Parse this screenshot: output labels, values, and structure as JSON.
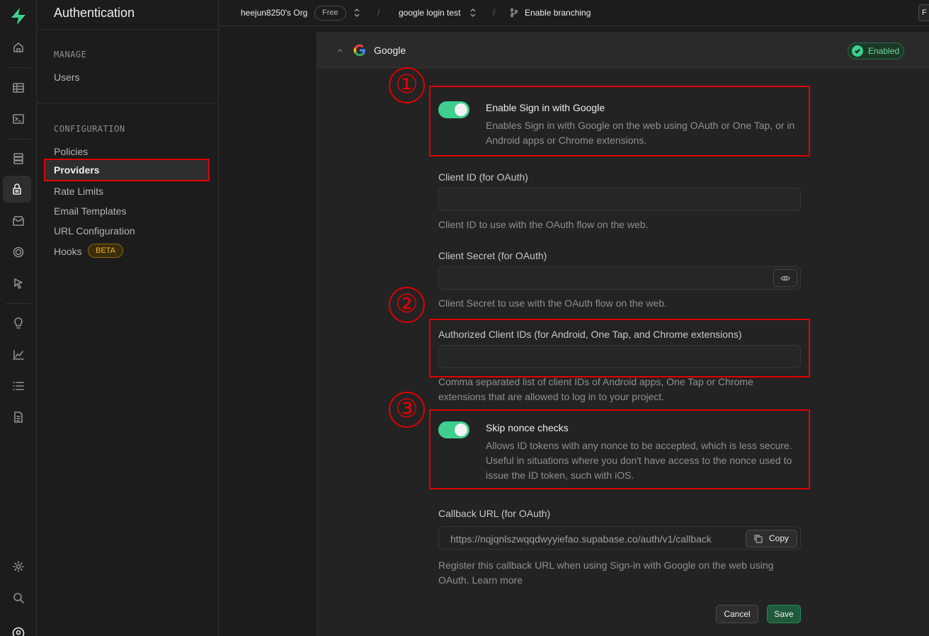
{
  "app": {
    "section_title": "Authentication"
  },
  "sidebar": {
    "manage_head": "MANAGE",
    "manage_items": [
      {
        "label": "Users"
      }
    ],
    "config_head": "CONFIGURATION",
    "config_items": [
      {
        "label": "Policies"
      },
      {
        "label": "Providers"
      },
      {
        "label": "Rate Limits"
      },
      {
        "label": "Email Templates"
      },
      {
        "label": "URL Configuration"
      },
      {
        "label": "Hooks"
      }
    ],
    "active_item": "Providers",
    "beta_badge": "BETA"
  },
  "topbar": {
    "org": "heejun8250's Org",
    "plan": "Free",
    "project": "google login test",
    "branching": "Enable branching",
    "edge_button": "F"
  },
  "provider": {
    "name": "Google",
    "status": "Enabled",
    "enable": {
      "label": "Enable Sign in with Google",
      "desc_line1": "Enables Sign in with Google on the web using OAuth or One Tap, or in",
      "desc_line2": "Android apps or Chrome extensions.",
      "on": true
    },
    "client_id": {
      "label": "Client ID (for OAuth)",
      "value": "",
      "help": "Client ID to use with the OAuth flow on the web."
    },
    "client_secret": {
      "label": "Client Secret (for OAuth)",
      "value": "",
      "help": "Client Secret to use with the OAuth flow on the web."
    },
    "authorized_ids": {
      "label": "Authorized Client IDs (for Android, One Tap, and Chrome extensions)",
      "value": "",
      "help_line1": "Comma separated list of client IDs of Android apps, One Tap or Chrome",
      "help_line2": "extensions that are allowed to log in to your project."
    },
    "skip_nonce": {
      "label": "Skip nonce checks",
      "desc_line1": "Allows ID tokens with any nonce to be accepted, which is less secure.",
      "desc_line2": "Useful in situations where you don't have access to the nonce used to",
      "desc_line3": "issue the ID token, such with iOS.",
      "on": true
    },
    "callback": {
      "label": "Callback URL (for OAuth)",
      "url": "https://nqjqnlszwqqdwyyiefao.supabase.co/auth/v1/callback",
      "copy_label": "Copy",
      "help_line1": "Register this callback URL when using Sign-in with Google on the web using",
      "help_line2": "OAuth. Learn more"
    },
    "cancel_label": "Cancel",
    "save_label": "Save"
  },
  "annotations": [
    "①",
    "②",
    "③"
  ],
  "colors": {
    "accent": "#3ecf8e",
    "highlight": "#e00000",
    "beta": "#f1b42a"
  },
  "icons": [
    "home-icon",
    "table-icon",
    "terminal-icon",
    "database-icon",
    "auth-lock-icon",
    "storage-icon",
    "realtime-icon",
    "edge-functions-icon",
    "advisor-bulb-icon",
    "reports-icon",
    "logs-icon",
    "docs-icon",
    "settings-icon",
    "search-icon"
  ]
}
